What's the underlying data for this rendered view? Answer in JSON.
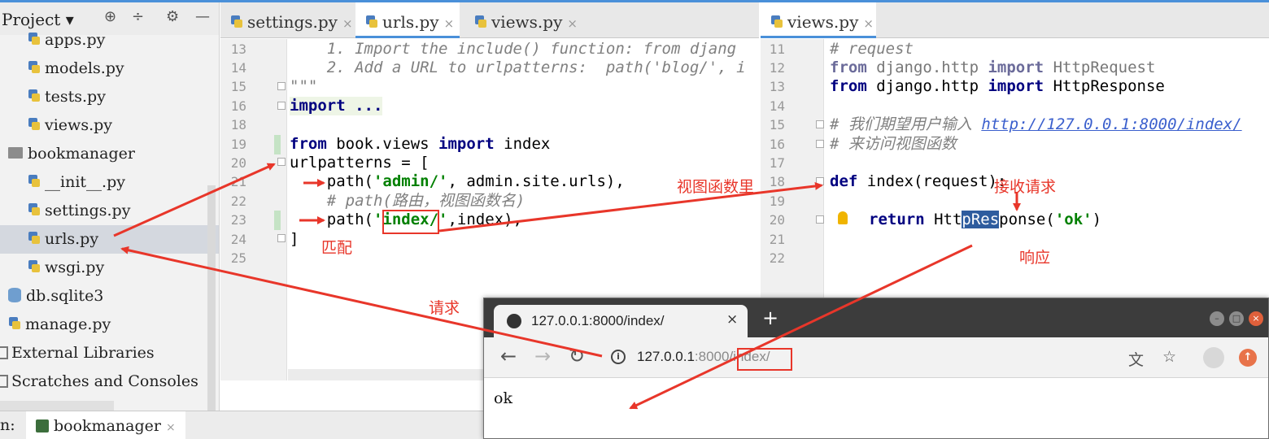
{
  "project_panel": {
    "title": "Project ▾",
    "icons": [
      "target-icon",
      "collapse-icon",
      "gear-icon",
      "minimize-icon"
    ],
    "items": [
      {
        "label": "apps.py",
        "type": "py"
      },
      {
        "label": "models.py",
        "type": "py"
      },
      {
        "label": "tests.py",
        "type": "py"
      },
      {
        "label": "views.py",
        "type": "py"
      },
      {
        "label": "bookmanager",
        "type": "folder"
      },
      {
        "label": "__init__.py",
        "type": "py"
      },
      {
        "label": "settings.py",
        "type": "py"
      },
      {
        "label": "urls.py",
        "type": "py",
        "selected": true
      },
      {
        "label": "wsgi.py",
        "type": "py"
      },
      {
        "label": "db.sqlite3",
        "type": "db"
      },
      {
        "label": "manage.py",
        "type": "py"
      },
      {
        "label": "External Libraries",
        "type": "lib"
      },
      {
        "label": "Scratches and Consoles",
        "type": "scratch"
      }
    ]
  },
  "left_editor": {
    "tabs": [
      {
        "label": "settings.py",
        "close": "×"
      },
      {
        "label": "urls.py",
        "close": "×",
        "active": true
      },
      {
        "label": "views.py",
        "close": "×"
      }
    ],
    "lines": [
      {
        "num": "13",
        "text": "    1. Import the include() function: from djang"
      },
      {
        "num": "14",
        "text": "    2. Add a URL to urlpatterns:  path('blog/', i"
      },
      {
        "num": "15",
        "text": "\"\"\""
      },
      {
        "num": "16",
        "text": "import ..."
      },
      {
        "num": "18",
        "text": ""
      },
      {
        "num": "19",
        "kw1": "from",
        "mid": " book.views ",
        "kw2": "import",
        "tail": " index"
      },
      {
        "num": "20",
        "text": "urlpatterns = ["
      },
      {
        "num": "21",
        "pre": "    path(",
        "str": "'admin/'",
        "post": ", admin.site.urls),"
      },
      {
        "num": "22",
        "text": "    # path(路由，视图函数名)"
      },
      {
        "num": "23",
        "pre": "    path(",
        "str": "'index/'",
        "post": ",index),"
      },
      {
        "num": "24",
        "text": "]"
      },
      {
        "num": "25",
        "text": ""
      }
    ]
  },
  "right_editor": {
    "tabs": [
      {
        "label": "views.py",
        "close": "×",
        "active": true
      }
    ],
    "lines": [
      {
        "num": "11",
        "text": "# request"
      },
      {
        "num": "12",
        "kw1": "from",
        "mid": " django.http ",
        "kw2": "import",
        "tail": " HttpRequest",
        "dim": true
      },
      {
        "num": "13",
        "kw1": "from",
        "mid": " django.http ",
        "kw2": "import",
        "tail": " HttpResponse"
      },
      {
        "num": "14",
        "text": ""
      },
      {
        "num": "15",
        "comment": "# 我们期望用户输入 ",
        "link": "http://127.0.0.1:8000/index/"
      },
      {
        "num": "16",
        "text": "# 来访问视图函数"
      },
      {
        "num": "17",
        "text": ""
      },
      {
        "num": "18",
        "kw1": "def",
        "tail": " index(request):"
      },
      {
        "num": "19",
        "text": ""
      },
      {
        "num": "20",
        "kw1": "return",
        "pre": " Htt",
        "sel": "pRes",
        "post": "ponse(",
        "str": "'ok'",
        "end": ")"
      },
      {
        "num": "21",
        "text": ""
      },
      {
        "num": "22",
        "text": ""
      }
    ]
  },
  "run_bar": {
    "label": "n:",
    "tab": "bookmanager",
    "close": "×"
  },
  "browser": {
    "tab_title": "127.0.0.1:8000/index/",
    "tab_close": "×",
    "new_tab": "+",
    "url_host": "127.0.0.1",
    "url_port": ":8000",
    "url_path": "/index/",
    "page_text": "ok"
  },
  "annotations": {
    "match": "匹配",
    "view_function": "视图函数里",
    "receive_request": "接收请求",
    "response": "响应",
    "request": "请求"
  },
  "colors": {
    "annotation": "#e8362a",
    "keyword": "#000080",
    "string": "#008000",
    "comment": "#808080",
    "accent": "#4a90d9"
  }
}
